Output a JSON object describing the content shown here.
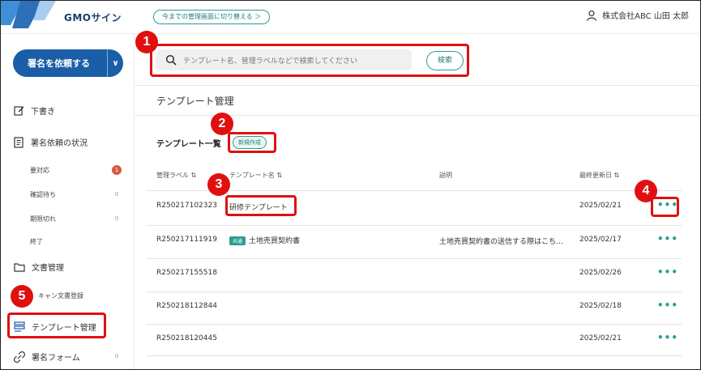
{
  "header": {
    "brand": "GMOサイン",
    "switch_label": "今までの管理画面に切り替える ＞",
    "user_name": "株式会社ABC  山田 太郎"
  },
  "sidebar": {
    "request_button": "署名を依頼する",
    "items": [
      {
        "label": "下書き",
        "icon": "edit-icon"
      },
      {
        "label": "署名依頼の状況",
        "icon": "document-list-icon"
      },
      {
        "label": "文書管理",
        "icon": "folder-icon"
      },
      {
        "label": "テンプレート管理",
        "icon": "template-icon"
      },
      {
        "label": "署名フォーム",
        "icon": "link-icon"
      }
    ],
    "status_subitems": [
      {
        "label": "要対応",
        "count": "1"
      },
      {
        "label": "確認待ち",
        "count": "0"
      },
      {
        "label": "期限切れ",
        "count": "0"
      },
      {
        "label": "終了",
        "count": ""
      }
    ],
    "doc_subitem": "キャン文書登録",
    "form_count": "0"
  },
  "search": {
    "placeholder": "テンプレート名、管理ラベルなどで検索してください",
    "button": "検索"
  },
  "page_title": "テンプレート管理",
  "section": {
    "title": "テンプレート一覧",
    "new_button": "新規作成"
  },
  "table": {
    "columns": [
      "管理ラベル",
      "テンプレート名",
      "説明",
      "最終更新日"
    ],
    "rows": [
      {
        "label": "R250217102323",
        "name": "研修テンプレート",
        "tag": "",
        "description": "",
        "date": "2025/02/21"
      },
      {
        "label": "R250217111919",
        "name": "土地売買契約書",
        "tag": "共通",
        "description": "土地売買契約書の送信する際はこち…",
        "date": "2025/02/17"
      },
      {
        "label": "R250217155518",
        "name": "",
        "tag": "",
        "description": "",
        "date": "2025/02/26"
      },
      {
        "label": "R250218112844",
        "name": "",
        "tag": "",
        "description": "",
        "date": "2025/02/18"
      },
      {
        "label": "R250218120445",
        "name": "",
        "tag": "",
        "description": "",
        "date": "2025/02/21"
      }
    ],
    "more_label": "•••"
  },
  "annotations": [
    "1",
    "2",
    "3",
    "4",
    "5"
  ],
  "colors": {
    "accent": "#2a9d8f",
    "primary": "#1a5ea8",
    "highlight": "#e01010"
  }
}
